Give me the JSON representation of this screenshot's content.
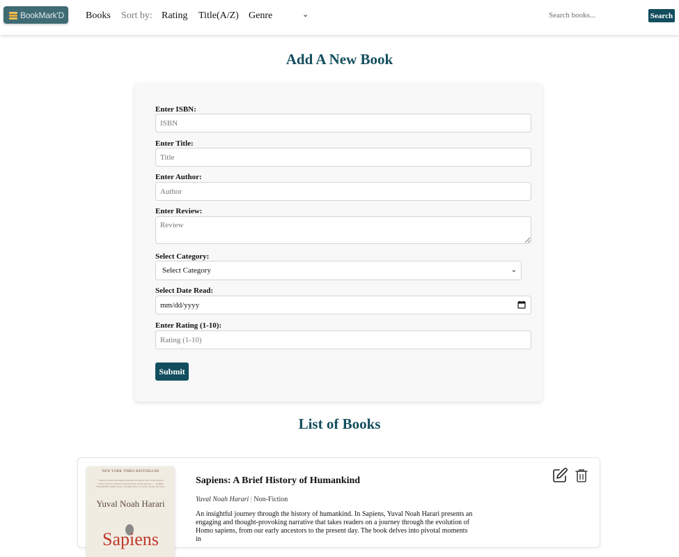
{
  "nav": {
    "brand": "BookMark'D",
    "books": "Books",
    "sort_by": "Sort by:",
    "rating": "Rating",
    "title_az": "Title(A/Z)",
    "genre": "Genre",
    "search_placeholder": "Search books...",
    "search_button": "Search"
  },
  "form": {
    "heading": "Add A New Book",
    "isbn_label": "Enter ISBN:",
    "isbn_placeholder": "ISBN",
    "title_label": "Enter Title:",
    "title_placeholder": "Title",
    "author_label": "Enter Author:",
    "author_placeholder": "Author",
    "review_label": "Enter Review:",
    "review_placeholder": "Review",
    "category_label": "Select Category:",
    "category_value": "Select Category",
    "date_label": "Select Date Read:",
    "date_value": "mm/dd/yyyy",
    "rating_label": "Enter Rating (1-10):",
    "rating_placeholder": "Rating (1-10)",
    "submit": "Submit"
  },
  "list": {
    "heading": "List of Books",
    "books": [
      {
        "title": "Sapiens: A Brief History of Humankind",
        "author": "Yuval Noah Harari",
        "separator": "|",
        "category": "Non-Fiction",
        "description": "An insightful journey through the history of humankind. In Sapiens, Yuval Noah Harari presents an engaging and thought-provoking narrative that takes readers on a journey through the evolution of Homo sapiens, from our early ancestors to the present day. The book delves into pivotal moments in",
        "cover": {
          "banner": "NEW YORK TIMES BESTSELLER",
          "blurb": "\"Sapiens tackles the biggest questions of history and of the modern world, and it is written in unforgettably vivid language.\" —JARED DIAMOND, Pulitzer Prize–winning author of Guns, Germs, and Steel",
          "author": "Yuval Noah Harari",
          "title": "Sapiens"
        }
      }
    ]
  },
  "colors": {
    "accent": "#134e5e",
    "brand_bg": "#3f6b74",
    "card_bg": "#f8f8f8"
  },
  "icons": {
    "brand": "books-stack-icon",
    "edit": "edit-icon",
    "delete": "trash-icon",
    "calendar": "calendar-icon",
    "dropdown": "chevron-down-icon"
  }
}
